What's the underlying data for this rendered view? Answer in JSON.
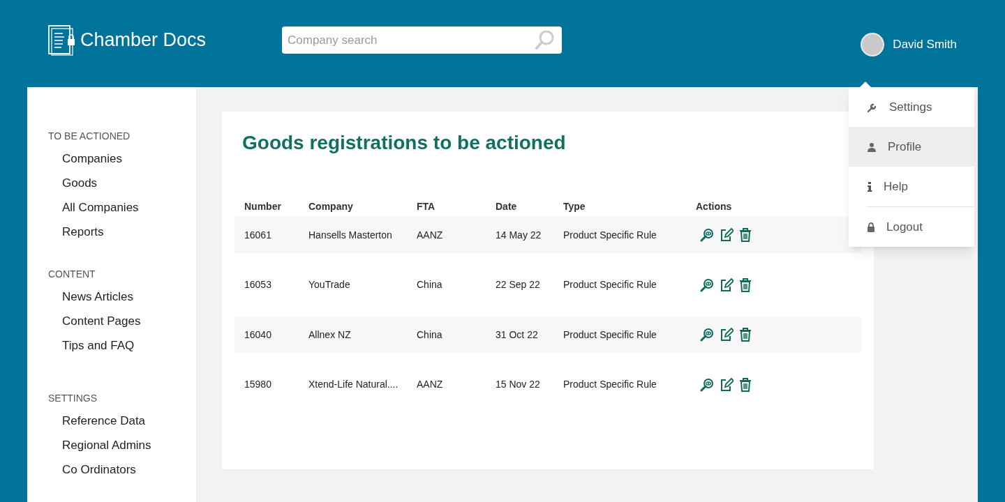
{
  "header": {
    "logo": "Chamber Docs",
    "search": {
      "placeholder": "Company search"
    },
    "user": {
      "name": "David Smith"
    }
  },
  "user_menu": [
    {
      "label": "Settings",
      "kind": "wrench",
      "selected": false
    },
    {
      "label": "Profile",
      "kind": "person",
      "selected": true
    },
    {
      "label": "Help",
      "kind": "info",
      "selected": false
    },
    {
      "label": "Logout",
      "kind": "lock",
      "selected": false
    }
  ],
  "sidebar": [
    {
      "heading": "TO BE ACTIONED",
      "items": [
        "Companies",
        "Goods",
        "All Companies",
        "Reports"
      ]
    },
    {
      "heading": "CONTENT",
      "items": [
        "News Articles",
        "Content Pages",
        "Tips and FAQ"
      ]
    },
    {
      "heading": "SETTINGS",
      "items": [
        "Reference Data",
        "Regional Admins",
        "Co Ordinators"
      ]
    }
  ],
  "page": {
    "title": "Goods registrations to be actioned"
  },
  "table": {
    "columns": [
      "Number",
      "Company",
      "FTA",
      "Date",
      "Type",
      "Actions"
    ],
    "rows": [
      [
        "16061",
        "Hansells Masterton",
        "AANZ",
        "14 May 22",
        "Product Specific Rule"
      ],
      [
        "16053",
        "YouTrade",
        "China",
        "22 Sep 22",
        "Product Specific Rule"
      ],
      [
        "16040",
        "Allnex NZ",
        "China",
        "31 Oct 22",
        "Product Specific Rule"
      ],
      [
        "15980",
        "Xtend-Life Natural....",
        "AANZ",
        "15 Nov 22",
        "Product Specific Rule"
      ]
    ]
  }
}
